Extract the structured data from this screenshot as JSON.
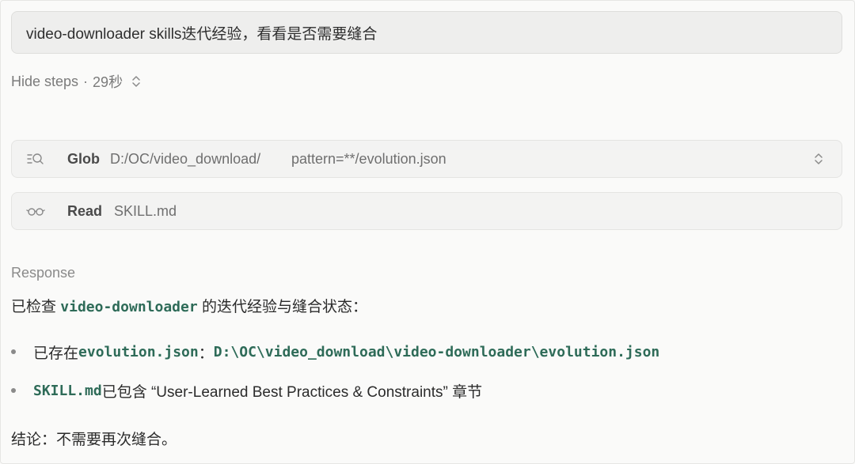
{
  "prompt": {
    "text": "video-downloader skills迭代经验，看看是否需要缝合"
  },
  "steps_toggle": {
    "label": "Hide steps",
    "separator": "·",
    "duration": "29秒"
  },
  "steps": {
    "glob": {
      "tool": "Glob",
      "path": "D:/OC/video_download/",
      "pattern": "pattern=**/evolution.json",
      "icon": "list-search-icon"
    },
    "read": {
      "tool": "Read",
      "file": "SKILL.md",
      "icon": "glasses-icon"
    }
  },
  "response": {
    "label": "Response",
    "intro_prefix": "已检查 ",
    "intro_code": "video-downloader",
    "intro_suffix": " 的迭代经验与缝合状态：",
    "bullets": [
      {
        "prefix": "已存在 ",
        "code1": "evolution.json",
        "mid": "：",
        "code2": "D:\\OC\\video_download\\video-downloader\\evolution.json"
      },
      {
        "code1": "SKILL.md",
        "suffix": " 已包含 “User-Learned Best Practices & Constraints” 章节"
      }
    ],
    "conclusion": "结论：不需要再次缝合。"
  },
  "colors": {
    "code": "#2e6b58",
    "muted": "#7b7b7b",
    "panel": "#f3f3f2"
  }
}
